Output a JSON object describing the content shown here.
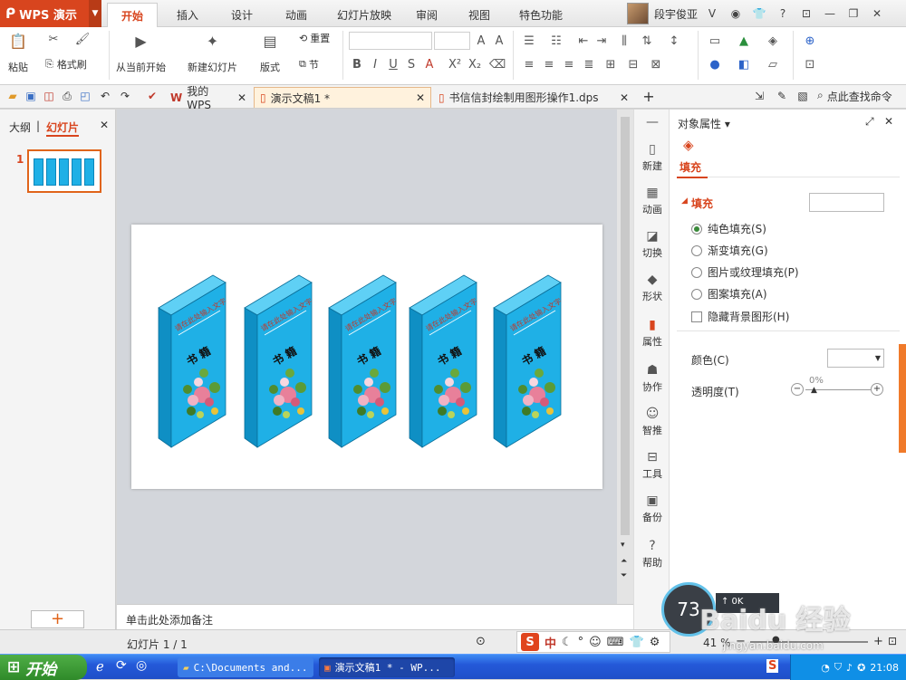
{
  "app": {
    "logo": "WPS 演示"
  },
  "tabs": [
    "开始",
    "插入",
    "设计",
    "动画",
    "幻灯片放映",
    "审阅",
    "视图",
    "特色功能"
  ],
  "user": {
    "name": "段宇俊亚"
  },
  "ribbon": {
    "paste": "粘贴",
    "format_painter": "格式刷",
    "from_current": "从当前开始",
    "new_slide": "新建幻灯片",
    "layout": "版式",
    "reset": "重置",
    "section": "节"
  },
  "doc_tabs": [
    {
      "label": "我的WPS"
    },
    {
      "label": "演示文稿1 *"
    },
    {
      "label": "书信信封绘制用图形操作1.dps"
    }
  ],
  "search_cmd": "点此查找命令",
  "left_panel": {
    "outline_tab": "大纲",
    "slides_tab": "幻灯片",
    "slide_number": "1",
    "add_label": "+"
  },
  "slide": {
    "books": [
      {
        "title": "请在此处输入文字",
        "chars": "书 籍"
      },
      {
        "title": "请在此处输入文字",
        "chars": "书 籍"
      },
      {
        "title": "请在此处输入文字",
        "chars": "书 籍"
      },
      {
        "title": "请在此处输入文字",
        "chars": "书 籍"
      },
      {
        "title": "请在此处输入文字",
        "chars": "书 籍"
      }
    ]
  },
  "notes_placeholder": "单击此处添加备注",
  "rail": [
    {
      "label": "新建",
      "icon": "new-icon"
    },
    {
      "label": "动画",
      "icon": "animation-icon"
    },
    {
      "label": "切换",
      "icon": "transition-icon"
    },
    {
      "label": "形状",
      "icon": "shape-icon"
    },
    {
      "label": "属性",
      "icon": "property-icon"
    },
    {
      "label": "协作",
      "icon": "collab-icon"
    },
    {
      "label": "智推",
      "icon": "smart-icon"
    },
    {
      "label": "工具",
      "icon": "tool-icon"
    },
    {
      "label": "备份",
      "icon": "backup-icon"
    },
    {
      "label": "帮助",
      "icon": "help-icon"
    }
  ],
  "props": {
    "header": "对象属性 ▾",
    "fill_tab": "填充",
    "fill_section": "填充",
    "options": [
      {
        "label": "纯色填充(S)",
        "checked": true
      },
      {
        "label": "渐变填充(G)",
        "checked": false
      },
      {
        "label": "图片或纹理填充(P)",
        "checked": false
      },
      {
        "label": "图案填充(A)",
        "checked": false
      }
    ],
    "hide_bg": "隐藏背景图形(H)",
    "color_label": "颜色(C)",
    "transparency_label": "透明度(T)",
    "transparency_value": "0%"
  },
  "status": {
    "slide_info": "幻灯片 1 / 1",
    "zoom": "41 %"
  },
  "taskbar": {
    "start": "开始",
    "task1": "C:\\Documents and...",
    "task2": "演示文稿1 * - WP...",
    "clock": "21:08"
  },
  "overlay": {
    "gauge_value": "73",
    "ime_char": "中",
    "watermark": "Baidu 经验",
    "watermark_url": "jingyan.baidu.com"
  },
  "colors": {
    "accent": "#d8451e",
    "book_blue": "#1fb0e6",
    "taskbar": "#245edb"
  }
}
